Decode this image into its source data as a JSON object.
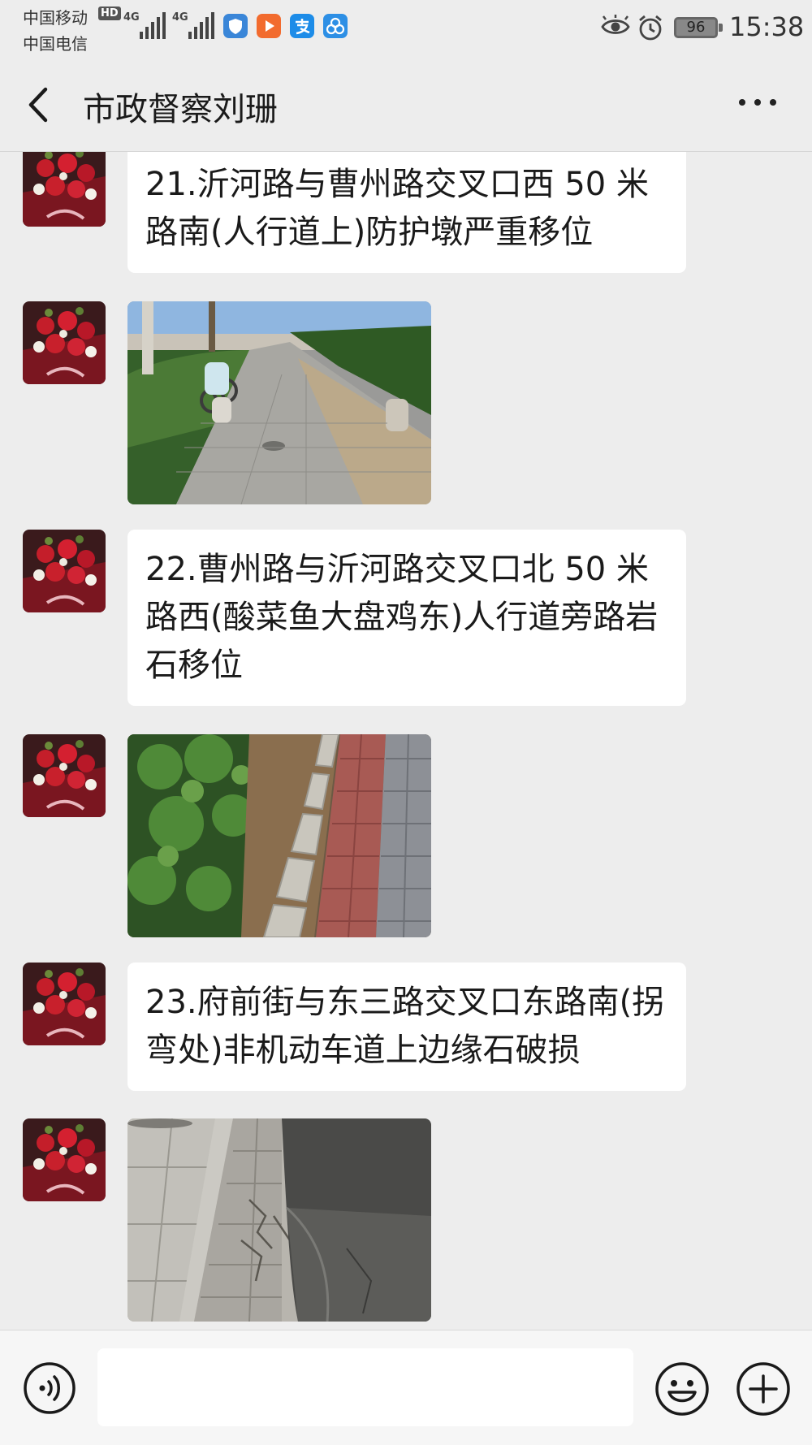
{
  "status_bar": {
    "carrier_1": "中国移动",
    "hd_label": "HD",
    "carrier_2": "中国电信",
    "network_1": "4G",
    "network_2": "4G",
    "battery_level": "96",
    "time": "15:38",
    "icons": [
      "eye-icon",
      "alarm-icon"
    ],
    "app_icons": [
      "shield-app-icon",
      "video-app-icon",
      "alipay-app-icon",
      "triangle-app-icon"
    ]
  },
  "header": {
    "title": "市政督察刘珊",
    "back_icon": "chevron-left-icon",
    "more_icon": "more-dots-icon"
  },
  "messages": [
    {
      "type": "text",
      "text": "21.沂河路与曹州路交叉口西 50 米路南(人行道上)防护墩严重移位"
    },
    {
      "type": "image",
      "description_icon": "photo"
    },
    {
      "type": "text",
      "text": "22.曹州路与沂河路交叉口北 50 米路西(酸菜鱼大盘鸡东)人行道旁路岩石移位"
    },
    {
      "type": "image",
      "description_icon": "photo"
    },
    {
      "type": "text",
      "text": "23.府前街与东三路交叉口东路南(拐弯处)非机动车道上边缘石破损"
    },
    {
      "type": "image",
      "description_icon": "photo"
    }
  ],
  "input_bar": {
    "voice_icon": "voice-icon",
    "text_value": "",
    "emoji_icon": "emoji-icon",
    "plus_icon": "plus-icon"
  },
  "colors": {
    "background": "#ededed",
    "bubble": "#ffffff",
    "text": "#1a1a1a"
  }
}
